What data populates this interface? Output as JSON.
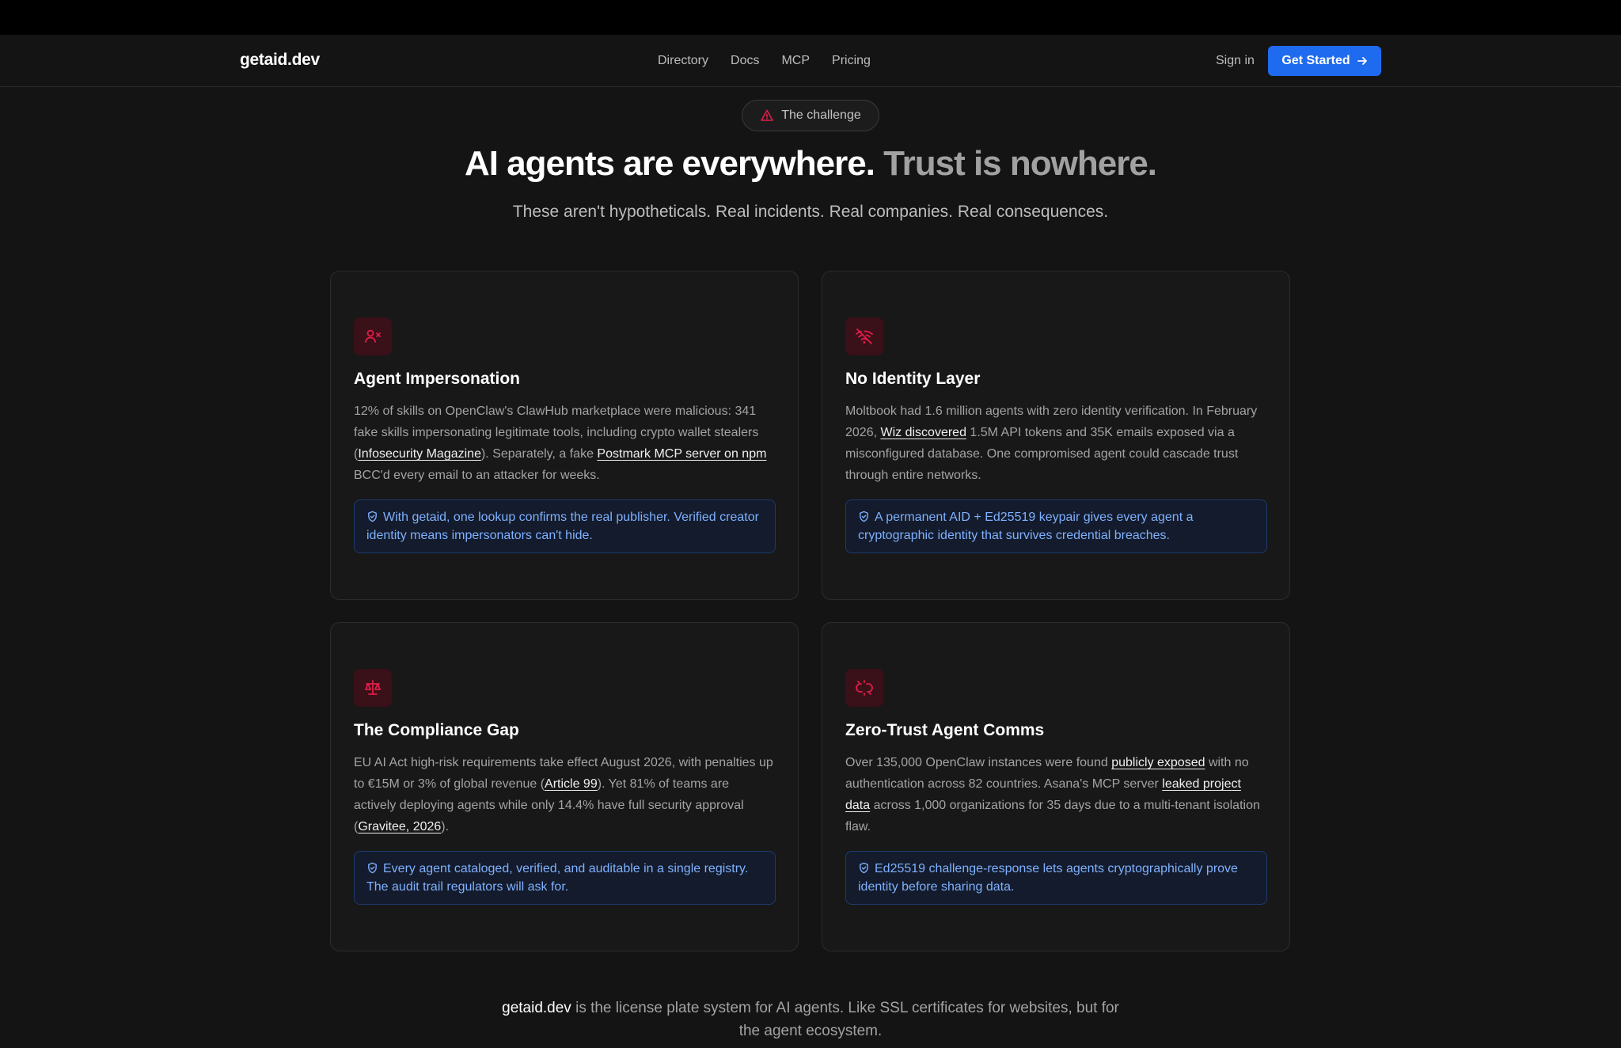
{
  "nav": {
    "logo": "getaid.dev",
    "links": [
      "Directory",
      "Docs",
      "MCP",
      "Pricing"
    ],
    "signin": "Sign in",
    "cta": "Get Started"
  },
  "hero": {
    "pill": "The challenge",
    "title_main": "AI agents are everywhere.",
    "title_muted": "Trust is nowhere.",
    "subtitle": "These aren't hypotheticals. Real incidents. Real companies. Real consequences."
  },
  "cards": [
    {
      "icon": "user-x-icon",
      "title": "Agent Impersonation",
      "body": [
        {
          "t": "12% of skills on OpenClaw's ClawHub marketplace were malicious: 341 fake skills impersonating legitimate tools, including crypto wallet stealers ("
        },
        {
          "t": "Infosecurity Magazine",
          "link": true
        },
        {
          "t": "). Separately, a fake "
        },
        {
          "t": "Postmark MCP server on npm",
          "link": true
        },
        {
          "t": " BCC'd every email to an attacker for weeks."
        }
      ],
      "callout": "With getaid, one lookup confirms the real publisher. Verified creator identity means impersonators can't hide."
    },
    {
      "icon": "wifi-off-icon",
      "title": "No Identity Layer",
      "body": [
        {
          "t": "Moltbook had 1.6 million agents with zero identity verification. In February 2026, "
        },
        {
          "t": "Wiz discovered",
          "link": true
        },
        {
          "t": " 1.5M API tokens and 35K emails exposed via a misconfigured database. One compromised agent could cascade trust through entire networks."
        }
      ],
      "callout": "A permanent AID + Ed25519 keypair gives every agent a cryptographic identity that survives credential breaches."
    },
    {
      "icon": "scale-icon",
      "title": "The Compliance Gap",
      "body": [
        {
          "t": "EU AI Act high-risk requirements take effect August 2026, with penalties up to €15M or 3% of global revenue ("
        },
        {
          "t": "Article 99",
          "link": true
        },
        {
          "t": "). Yet 81% of teams are actively deploying agents while only 14.4% have full security approval ("
        },
        {
          "t": "Gravitee, 2026",
          "link": true
        },
        {
          "t": ")."
        }
      ],
      "callout": "Every agent cataloged, verified, and auditable in a single registry. The audit trail regulators will ask for."
    },
    {
      "icon": "broken-link-icon",
      "title": "Zero-Trust Agent Comms",
      "body": [
        {
          "t": "Over 135,000 OpenClaw instances were found "
        },
        {
          "t": "publicly exposed",
          "link": true
        },
        {
          "t": " with no authentication across 82 countries. Asana's MCP server "
        },
        {
          "t": "leaked project data",
          "link": true
        },
        {
          "t": " across 1,000 organizations for 35 days due to a multi-tenant isolation flaw."
        }
      ],
      "callout": "Ed25519 challenge-response lets agents cryptographically prove identity before sharing data."
    }
  ],
  "footer": {
    "brand": "getaid.dev",
    "text": " is the license plate system for AI agents. Like SSL certificates for websites, but for the agent ecosystem."
  },
  "colors": {
    "accent": "#1f6bf0",
    "icon_red": "#e11d48",
    "callout_text": "#7fb1ff"
  }
}
